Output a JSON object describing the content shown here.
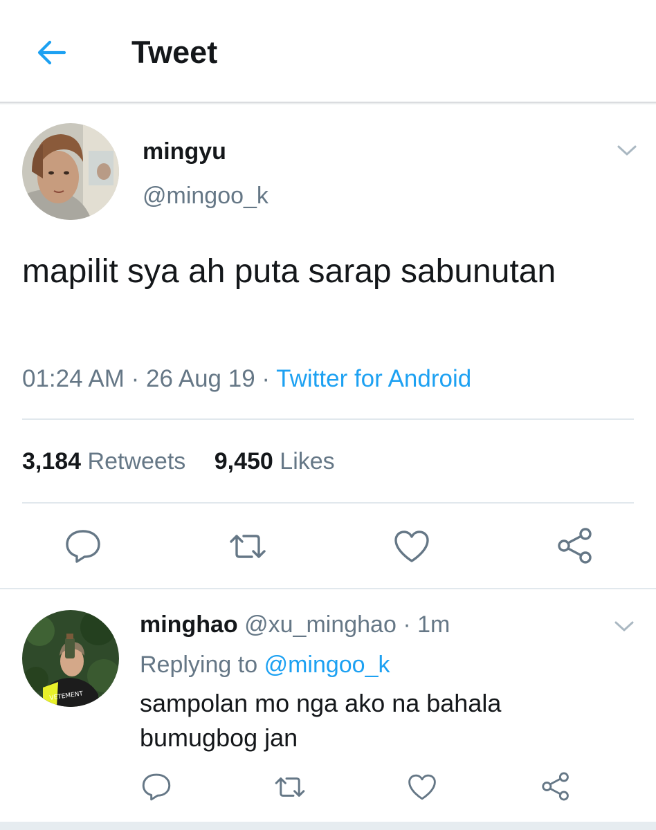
{
  "header": {
    "back_icon": "arrow-left-icon",
    "title": "Tweet"
  },
  "tweet": {
    "author_name": "mingyu",
    "author_handle": "@mingoo_k",
    "text": "mapilit sya ah puta sarap sabunutan",
    "time": "01:24 AM",
    "date": "26 Aug 19",
    "source": "Twitter for Android",
    "retweets_count": "3,184",
    "retweets_label": "Retweets",
    "likes_count": "9,450",
    "likes_label": "Likes",
    "actions": [
      "reply-icon",
      "retweet-icon",
      "like-icon",
      "share-icon"
    ]
  },
  "reply": {
    "author_name": "minghao",
    "author_handle": "@xu_minghao",
    "age": "1m",
    "replying_prefix": "Replying to",
    "replying_to": "@mingoo_k",
    "text": "sampolan mo nga ako na bahala bumugbog jan",
    "avatar_shirt_text": "VETEMENT"
  },
  "colors": {
    "accent": "#1da1f2",
    "text_primary": "#14171a",
    "text_secondary": "#657786",
    "divider": "#e1e8ed"
  }
}
